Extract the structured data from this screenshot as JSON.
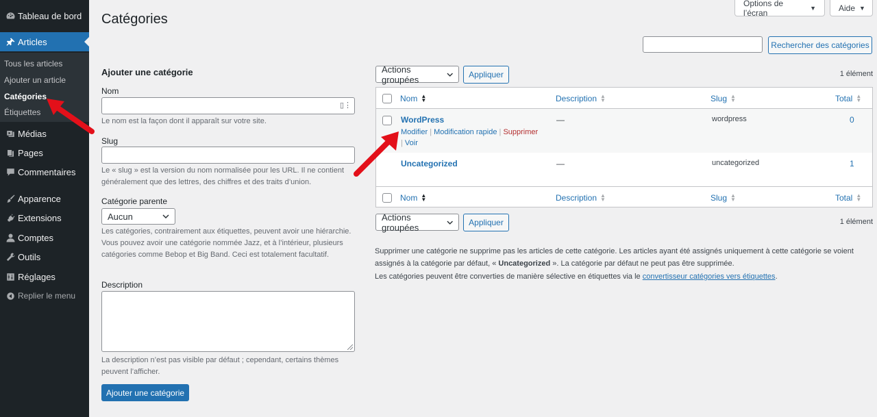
{
  "sidebar": {
    "dashboard": "Tableau de bord",
    "posts": "Articles",
    "submenu": [
      "Tous les articles",
      "Ajouter un article",
      "Catégories",
      "Étiquettes"
    ],
    "media": "Médias",
    "pages": "Pages",
    "comments": "Commentaires",
    "appearance": "Apparence",
    "plugins": "Extensions",
    "users": "Comptes",
    "tools": "Outils",
    "settings": "Réglages",
    "collapse": "Replier le menu"
  },
  "header": {
    "screen_options": "Options de l’écran",
    "help": "Aide",
    "title": "Catégories"
  },
  "search": {
    "value": "",
    "button": "Rechercher des catégories"
  },
  "form": {
    "heading": "Ajouter une catégorie",
    "name_label": "Nom",
    "name_value": "",
    "name_hint": "Le nom est la façon dont il apparaît sur votre site.",
    "slug_label": "Slug",
    "slug_value": "",
    "slug_hint": "Le « slug » est la version du nom normalisée pour les URL. Il ne contient généralement que des lettres, des chiffres et des traits d’union.",
    "parent_label": "Catégorie parente",
    "parent_value": "Aucun",
    "parent_hint": "Les catégories, contrairement aux étiquettes, peuvent avoir une hiérarchie. Vous pouvez avoir une catégorie nommée Jazz, et à l’intérieur, plusieurs catégories comme Bebop et Big Band. Ceci est totalement facultatif.",
    "description_label": "Description",
    "description_value": "",
    "description_hint": "La description n’est pas visible par défaut ; cependant, certains thèmes peuvent l’afficher.",
    "submit": "Ajouter une catégorie"
  },
  "bulk": {
    "select": "Actions groupées",
    "apply": "Appliquer",
    "count": "1 élément"
  },
  "table": {
    "columns": [
      "Nom",
      "Description",
      "Slug",
      "Total"
    ],
    "rows": [
      {
        "name": "WordPress",
        "description": "—",
        "slug": "wordpress",
        "count": "0"
      },
      {
        "name": "Uncategorized",
        "description": "—",
        "slug": "uncategorized",
        "count": "1"
      }
    ],
    "row_actions": {
      "edit": "Modifier",
      "quick_edit": "Modification rapide",
      "delete": "Supprimer",
      "view": "Voir",
      "sep": "|"
    }
  },
  "notes": {
    "line1_a": "Supprimer une catégorie ne supprime pas les articles de cette catégorie. Les articles ayant été assignés uniquement à cette catégorie se voient assignés à la catégorie par défaut, « ",
    "line1_bold": "Uncategorized",
    "line1_b": " ». La catégorie par défaut ne peut pas être supprimée.",
    "line2_a": "Les catégories peuvent être converties de manière sélective en étiquettes via le ",
    "line2_link": "convertisseur catégories vers étiquettes",
    "line2_b": "."
  },
  "colors": {
    "admin_bar": "#1d2327",
    "accent": "#2271b1",
    "annotation_arrow": "#e3101a",
    "delete": "#b32d2e"
  }
}
